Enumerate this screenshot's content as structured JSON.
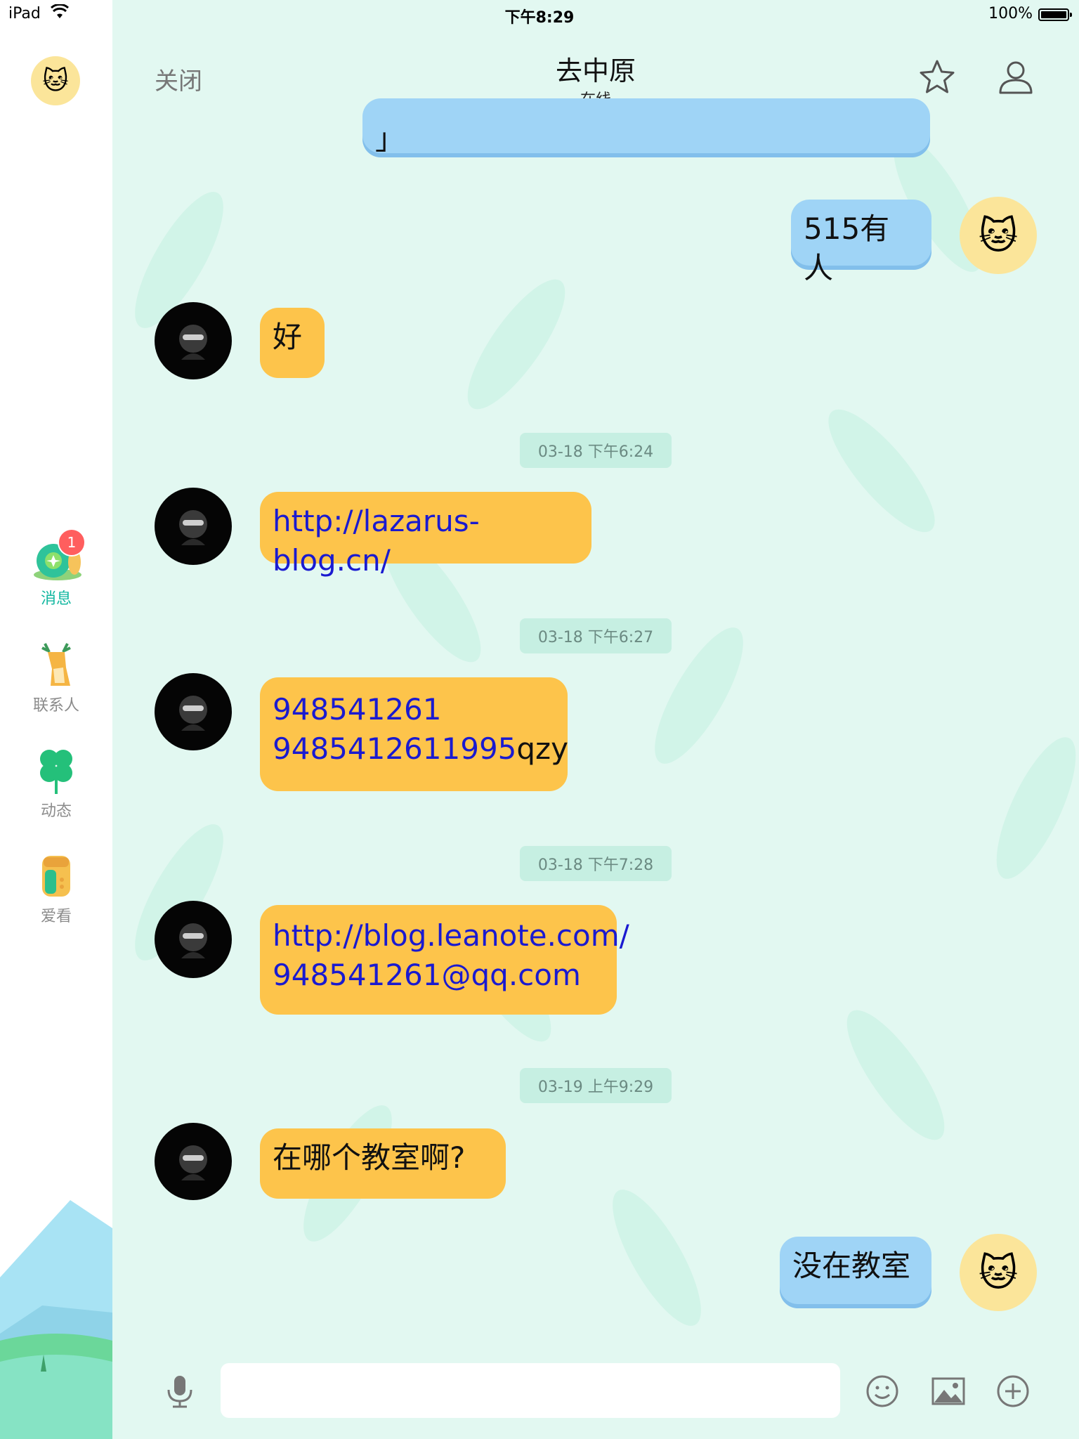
{
  "status_bar": {
    "device": "iPad",
    "time": "下午8:29",
    "battery": "100%"
  },
  "header": {
    "close_label": "关闭",
    "title": "去中原",
    "subtitle": "在线"
  },
  "sidebar": {
    "items": [
      {
        "label": "消息",
        "icon": "snail-icon",
        "badge": "1",
        "active": true
      },
      {
        "label": "联系人",
        "icon": "deer-icon"
      },
      {
        "label": "动态",
        "icon": "clover-icon"
      },
      {
        "label": "爱看",
        "icon": "owl-icon"
      }
    ]
  },
  "messages": [
    {
      "direction": "out",
      "text": "」"
    },
    {
      "direction": "out",
      "text": "515有人"
    },
    {
      "direction": "in",
      "text": "好"
    },
    {
      "timestamp": "03-18 下午6:24"
    },
    {
      "direction": "in",
      "lines": [
        "http://lazarus-blog.cn/"
      ]
    },
    {
      "timestamp": "03-18 下午6:27"
    },
    {
      "direction": "in",
      "lines": [
        "948541261",
        "9485412611995",
        "qzy"
      ]
    },
    {
      "timestamp": "03-18 下午7:28"
    },
    {
      "direction": "in",
      "lines": [
        "http://blog.leanote.com/",
        "948541261@qq.com"
      ]
    },
    {
      "timestamp": "03-19 上午9:29"
    },
    {
      "direction": "in",
      "text": "在哪个教室啊?"
    },
    {
      "direction": "out",
      "text": "没在教室"
    }
  ],
  "input_bar": {
    "placeholder": ""
  },
  "colors": {
    "incoming_bubble": "#fdc44b",
    "outgoing_bubble": "#9fd4f6",
    "link": "#1a1ad0",
    "accent": "#12b7a0",
    "background": "#e2f8f1"
  }
}
